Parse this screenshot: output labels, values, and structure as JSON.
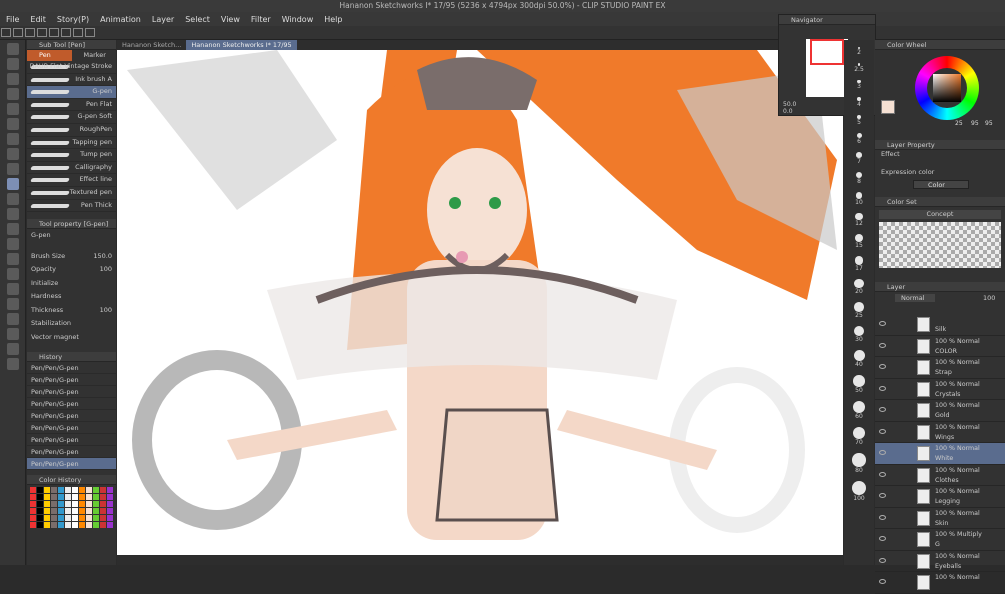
{
  "window": {
    "title": "Hananon Sketchworks I* 17/95 (5236 x 4794px 300dpi 50.0%) - CLIP STUDIO PAINT EX"
  },
  "menu": [
    "File",
    "Edit",
    "Story(P)",
    "Animation",
    "Layer",
    "Select",
    "View",
    "Filter",
    "Window",
    "Help"
  ],
  "subtool": {
    "header": "Sub Tool [Pen]",
    "tabs": [
      "Pen",
      "Marker"
    ],
    "brushes": [
      "DAUB Flat Vintage Stroke",
      "Ink brush A",
      "G-pen",
      "Pen Flat",
      "G-pen Soft",
      "RoughPen",
      "Tapping pen",
      "Tump pen",
      "Calligraphy",
      "Effect line",
      "Textured pen",
      "Pen Thick"
    ],
    "selected": 2
  },
  "tool_property": {
    "header": "Tool property [G-pen]",
    "name": "G-pen",
    "rows": [
      {
        "label": "Brush Size",
        "value": "150.0"
      },
      {
        "label": "Opacity",
        "value": "100"
      },
      {
        "label": "Initialize",
        "value": ""
      },
      {
        "label": "Hardness",
        "value": ""
      },
      {
        "label": "Thickness",
        "value": "100"
      },
      {
        "label": "Stabilization",
        "value": ""
      },
      {
        "label": "Vector magnet",
        "value": ""
      }
    ]
  },
  "history": {
    "header": "History",
    "items": [
      "Pen/Pen/G-pen",
      "Pen/Pen/G-pen",
      "Pen/Pen/G-pen",
      "Pen/Pen/G-pen",
      "Pen/Pen/G-pen",
      "Pen/Pen/G-pen",
      "Pen/Pen/G-pen",
      "Pen/Pen/G-pen",
      "Pen/Pen/G-pen"
    ],
    "selected": 8
  },
  "color_history": {
    "header": "Color History"
  },
  "tabs": [
    "Hananon Sketch...",
    "Hananon Sketchworks I* 17/95"
  ],
  "navigator": {
    "header": "Navigator",
    "zoom": "50.0",
    "angle": "0.0"
  },
  "brush_sizes": [
    "2",
    "2.5",
    "3",
    "4",
    "5",
    "6",
    "7",
    "8",
    "10",
    "12",
    "15",
    "17",
    "20",
    "25",
    "30",
    "40",
    "50",
    "60",
    "70",
    "80",
    "100"
  ],
  "color_wheel": {
    "header": "Color Wheel",
    "h": "25",
    "s": "95",
    "v": "95"
  },
  "layer_property": {
    "header": "Layer Property",
    "effect": "Effect",
    "expression_label": "Expression color",
    "expression": "Color"
  },
  "color_set": {
    "header": "Color Set",
    "name": "Concept"
  },
  "layer_panel": {
    "header": "Layer",
    "blend": "Normal",
    "opacity": "100",
    "layers": [
      {
        "mode": "",
        "name": "Silk"
      },
      {
        "mode": "100 % Normal",
        "name": "COLOR"
      },
      {
        "mode": "100 % Normal",
        "name": "Strap"
      },
      {
        "mode": "100 % Normal",
        "name": "Crystals"
      },
      {
        "mode": "100 % Normal",
        "name": "Gold"
      },
      {
        "mode": "100 % Normal",
        "name": "Wings"
      },
      {
        "mode": "100 % Normal",
        "name": "White"
      },
      {
        "mode": "100 % Normal",
        "name": "Clothes"
      },
      {
        "mode": "100 % Normal",
        "name": "Legging"
      },
      {
        "mode": "100 % Normal",
        "name": "Skin"
      },
      {
        "mode": "100 % Multiply",
        "name": "G"
      },
      {
        "mode": "100 % Normal",
        "name": "Eyeballs"
      },
      {
        "mode": "100 % Normal",
        "name": ""
      }
    ],
    "selected": 6
  },
  "colors": {
    "accent": "#5a6c8e",
    "hair": "#f07a2a",
    "bg": "#323232"
  }
}
